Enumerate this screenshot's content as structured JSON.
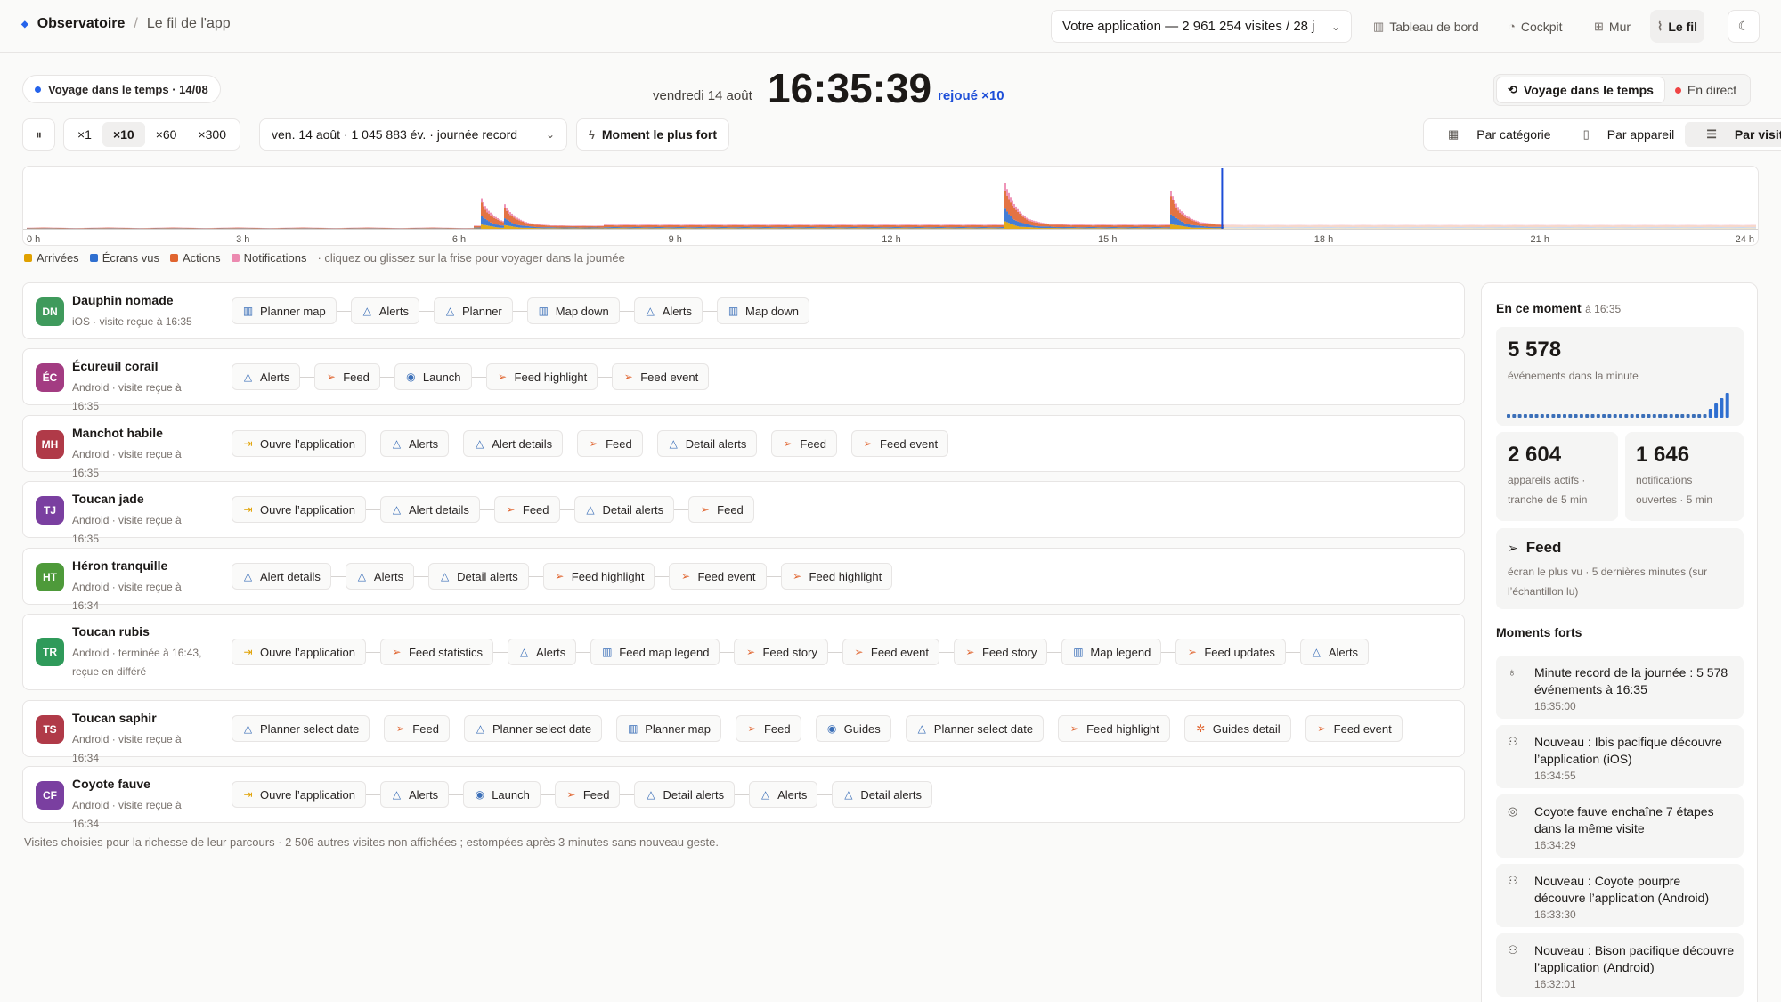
{
  "header": {
    "brand": "Observatoire",
    "separator": "/",
    "crumb": "Le fil de l'app",
    "app_select": "Votre application — 2 961 254 visites / 28 j",
    "nav": [
      {
        "label": "Tableau de bord",
        "icon": "bar-chart-icon"
      },
      {
        "label": "Cockpit",
        "icon": "gauge-icon"
      },
      {
        "label": "Mur",
        "icon": "grid-icon"
      },
      {
        "label": "Le fil",
        "icon": "activity-icon",
        "active": true
      }
    ]
  },
  "status": {
    "voyage_badge": "Voyage dans le temps · 14/08",
    "date": "vendredi 14 août",
    "time": "16:35:39",
    "replay": "rejoué ×10",
    "mode_voyage": "Voyage dans le temps",
    "mode_live": "En direct"
  },
  "controls": {
    "speeds": [
      "×1",
      "×10",
      "×60",
      "×300"
    ],
    "active_speed": "×10",
    "day_select": "ven. 14 août · 1 045 883 év. · journée record",
    "peak_button": "Moment le plus fort",
    "views": [
      "Par catégorie",
      "Par appareil",
      "Par visite"
    ],
    "active_view": "Par visite"
  },
  "timeline": {
    "hours": [
      "0 h",
      "3 h",
      "6 h",
      "9 h",
      "12 h",
      "15 h",
      "18 h",
      "21 h",
      "24 h"
    ],
    "legend": [
      {
        "label": "Arrivées",
        "color": "#e0a100"
      },
      {
        "label": "Écrans vus",
        "color": "#2f6fd0"
      },
      {
        "label": "Actions",
        "color": "#e0642f"
      },
      {
        "label": "Notifications",
        "color": "#ec8ab0"
      }
    ],
    "hint": "· cliquez ou glissez sur la frise pour voyager dans la journée",
    "cursor_hour": 16.59
  },
  "visits": [
    {
      "initials": "DN",
      "color": "#3f9a5c",
      "name": "Dauphin nomade",
      "sub": "iOS · visite reçue à 16:35",
      "steps": [
        [
          "Planner map",
          "map"
        ],
        [
          "Alerts",
          "alert"
        ],
        [
          "Planner",
          "alert"
        ],
        [
          "Map down",
          "map"
        ],
        [
          "Alerts",
          "alert"
        ],
        [
          "Map down",
          "map"
        ]
      ]
    },
    {
      "initials": "ÉC",
      "color": "#a33c82",
      "name": "Écureuil corail",
      "sub": "Android · visite reçue à 16:35",
      "steps": [
        [
          "Alerts",
          "alert"
        ],
        [
          "Feed",
          "send"
        ],
        [
          "Launch",
          "eye"
        ],
        [
          "Feed highlight",
          "send"
        ],
        [
          "Feed event",
          "send"
        ]
      ]
    },
    {
      "initials": "MH",
      "color": "#b03a48",
      "name": "Manchot habile",
      "sub": "Android · visite reçue à 16:35",
      "steps": [
        [
          "Ouvre l’application",
          "enter"
        ],
        [
          "Alerts",
          "alert"
        ],
        [
          "Alert details",
          "alert"
        ],
        [
          "Feed",
          "send"
        ],
        [
          "Detail alerts",
          "alert"
        ],
        [
          "Feed",
          "send"
        ],
        [
          "Feed event",
          "send"
        ]
      ]
    },
    {
      "initials": "TJ",
      "color": "#7a3fa0",
      "name": "Toucan jade",
      "sub": "Android · visite reçue à 16:35",
      "steps": [
        [
          "Ouvre l’application",
          "enter"
        ],
        [
          "Alert details",
          "alert"
        ],
        [
          "Feed",
          "send"
        ],
        [
          "Detail alerts",
          "alert"
        ],
        [
          "Feed",
          "send"
        ]
      ]
    },
    {
      "initials": "HT",
      "color": "#4e9a3a",
      "name": "Héron tranquille",
      "sub": "Android · visite reçue à 16:34",
      "steps": [
        [
          "Alert details",
          "alert"
        ],
        [
          "Alerts",
          "alert"
        ],
        [
          "Detail alerts",
          "alert"
        ],
        [
          "Feed highlight",
          "send"
        ],
        [
          "Feed event",
          "send"
        ],
        [
          "Feed highlight",
          "send"
        ]
      ]
    },
    {
      "initials": "TR",
      "color": "#2f9a5a",
      "name": "Toucan rubis",
      "sub": "Android · terminée à 16:43, reçue en différé",
      "steps": [
        [
          "Ouvre l’application",
          "enter"
        ],
        [
          "Feed statistics",
          "send"
        ],
        [
          "Alerts",
          "alert"
        ],
        [
          "Feed map legend",
          "map"
        ],
        [
          "Feed story",
          "send"
        ],
        [
          "Feed event",
          "send"
        ],
        [
          "Feed story",
          "send"
        ],
        [
          "Map legend",
          "map"
        ],
        [
          "Feed updates",
          "send"
        ],
        [
          "Alerts",
          "alert"
        ]
      ]
    },
    {
      "initials": "TS",
      "color": "#b03a48",
      "name": "Toucan saphir",
      "sub": "Android · visite reçue à 16:34",
      "steps": [
        [
          "Planner select date",
          "alert"
        ],
        [
          "Feed",
          "send"
        ],
        [
          "Planner select date",
          "alert"
        ],
        [
          "Planner map",
          "map"
        ],
        [
          "Feed",
          "send"
        ],
        [
          "Guides",
          "eye"
        ],
        [
          "Planner select date",
          "alert"
        ],
        [
          "Feed highlight",
          "send"
        ],
        [
          "Guides detail",
          "spark"
        ],
        [
          "Feed event",
          "send"
        ]
      ]
    },
    {
      "initials": "CF",
      "color": "#7a3fa0",
      "name": "Coyote fauve",
      "sub": "Android · visite reçue à 16:34",
      "steps": [
        [
          "Ouvre l’application",
          "enter"
        ],
        [
          "Alerts",
          "alert"
        ],
        [
          "Launch",
          "eye"
        ],
        [
          "Feed",
          "send"
        ],
        [
          "Detail alerts",
          "alert"
        ],
        [
          "Alerts",
          "alert"
        ],
        [
          "Detail alerts",
          "alert"
        ]
      ]
    }
  ],
  "footnote": "Visites choisies pour la richesse de leur parcours · 2 506 autres visites non affichées ; estompées après 3 minutes sans nouveau geste.",
  "sidebar": {
    "title": "En ce moment",
    "title_time": "à 16:35",
    "events": {
      "value": "5 578",
      "label": "événements dans la minute"
    },
    "devices": {
      "value": "2 604",
      "label": "appareils actifs · tranche de 5 min"
    },
    "notifs": {
      "value": "1 646",
      "label": "notifications ouvertes · 5 min"
    },
    "top_screen": {
      "name": "Feed",
      "label": "écran le plus vu · 5 dernières minutes (sur l’échantillon lu)"
    },
    "moments_title": "Moments forts",
    "moments": [
      {
        "icon": "award-icon",
        "text": "Minute record de la journée : 5 578 événements à 16:35",
        "time": "16:35:00"
      },
      {
        "icon": "user-plus-icon",
        "text": "Nouveau : Ibis pacifique découvre l’application (iOS)",
        "time": "16:34:55"
      },
      {
        "icon": "compass-icon",
        "text": "Coyote fauve enchaîne 7 étapes dans la même visite",
        "time": "16:34:29"
      },
      {
        "icon": "user-plus-icon",
        "text": "Nouveau : Coyote pourpre découvre l’application (Android)",
        "time": "16:33:30"
      },
      {
        "icon": "user-plus-icon",
        "text": "Nouveau : Bison pacifique découvre l’application (Android)",
        "time": "16:32:01"
      }
    ]
  }
}
